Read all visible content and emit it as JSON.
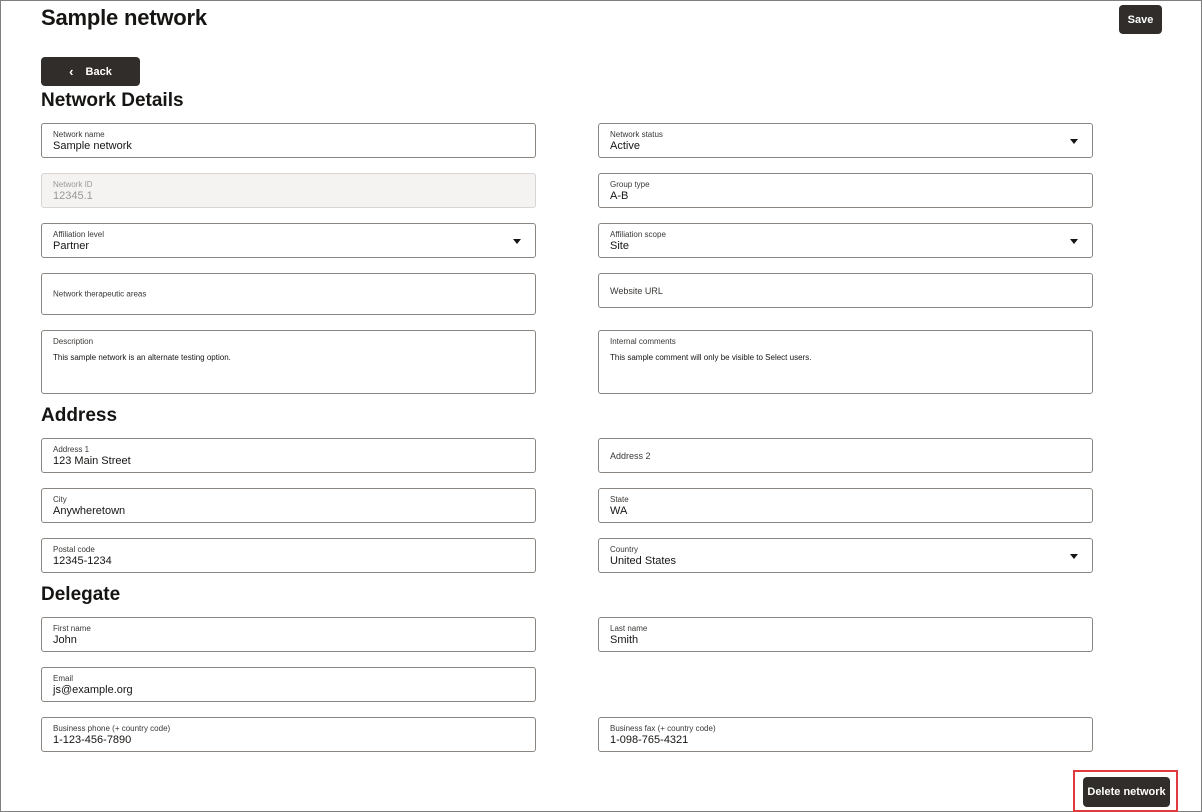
{
  "header": {
    "title": "Sample network",
    "save_label": "Save"
  },
  "nav": {
    "back_label": "Back"
  },
  "sections": {
    "network_details": "Network Details",
    "address": "Address",
    "delegate": "Delegate"
  },
  "network": {
    "name": {
      "label": "Network name",
      "value": "Sample network"
    },
    "status": {
      "label": "Network status",
      "value": "Active"
    },
    "id": {
      "label": "Network ID",
      "value": "12345.1"
    },
    "group_type": {
      "label": "Group type",
      "value": "A-B"
    },
    "affiliation_level": {
      "label": "Affiliation level",
      "value": "Partner"
    },
    "affiliation_scope": {
      "label": "Affiliation scope",
      "value": "Site"
    },
    "therapeutic_areas": {
      "label": "Network therapeutic areas",
      "value": ""
    },
    "website_url": {
      "label": "Website URL",
      "value": ""
    },
    "description": {
      "label": "Description",
      "value": "This sample network is an alternate testing option."
    },
    "internal_comments": {
      "label": "Internal comments",
      "value": "This sample comment will only be visible to Select users."
    }
  },
  "address": {
    "address1": {
      "label": "Address 1",
      "value": "123 Main Street"
    },
    "address2": {
      "label": "Address 2",
      "value": ""
    },
    "city": {
      "label": "City",
      "value": "Anywheretown"
    },
    "state": {
      "label": "State",
      "value": "WA"
    },
    "postal_code": {
      "label": "Postal code",
      "value": "12345-1234"
    },
    "country": {
      "label": "Country",
      "value": "United States"
    }
  },
  "delegate": {
    "first_name": {
      "label": "First name",
      "value": "John"
    },
    "last_name": {
      "label": "Last name",
      "value": "Smith"
    },
    "email": {
      "label": "Email",
      "value": "js@example.org"
    },
    "business_phone": {
      "label": "Business phone (+ country code)",
      "value": "1-123-456-7890"
    },
    "business_fax": {
      "label": "Business fax (+ country code)",
      "value": "1-098-765-4321"
    }
  },
  "footer": {
    "delete_label": "Delete network"
  },
  "colors": {
    "button_bg": "#312d2a",
    "highlight": "#e0393e"
  }
}
